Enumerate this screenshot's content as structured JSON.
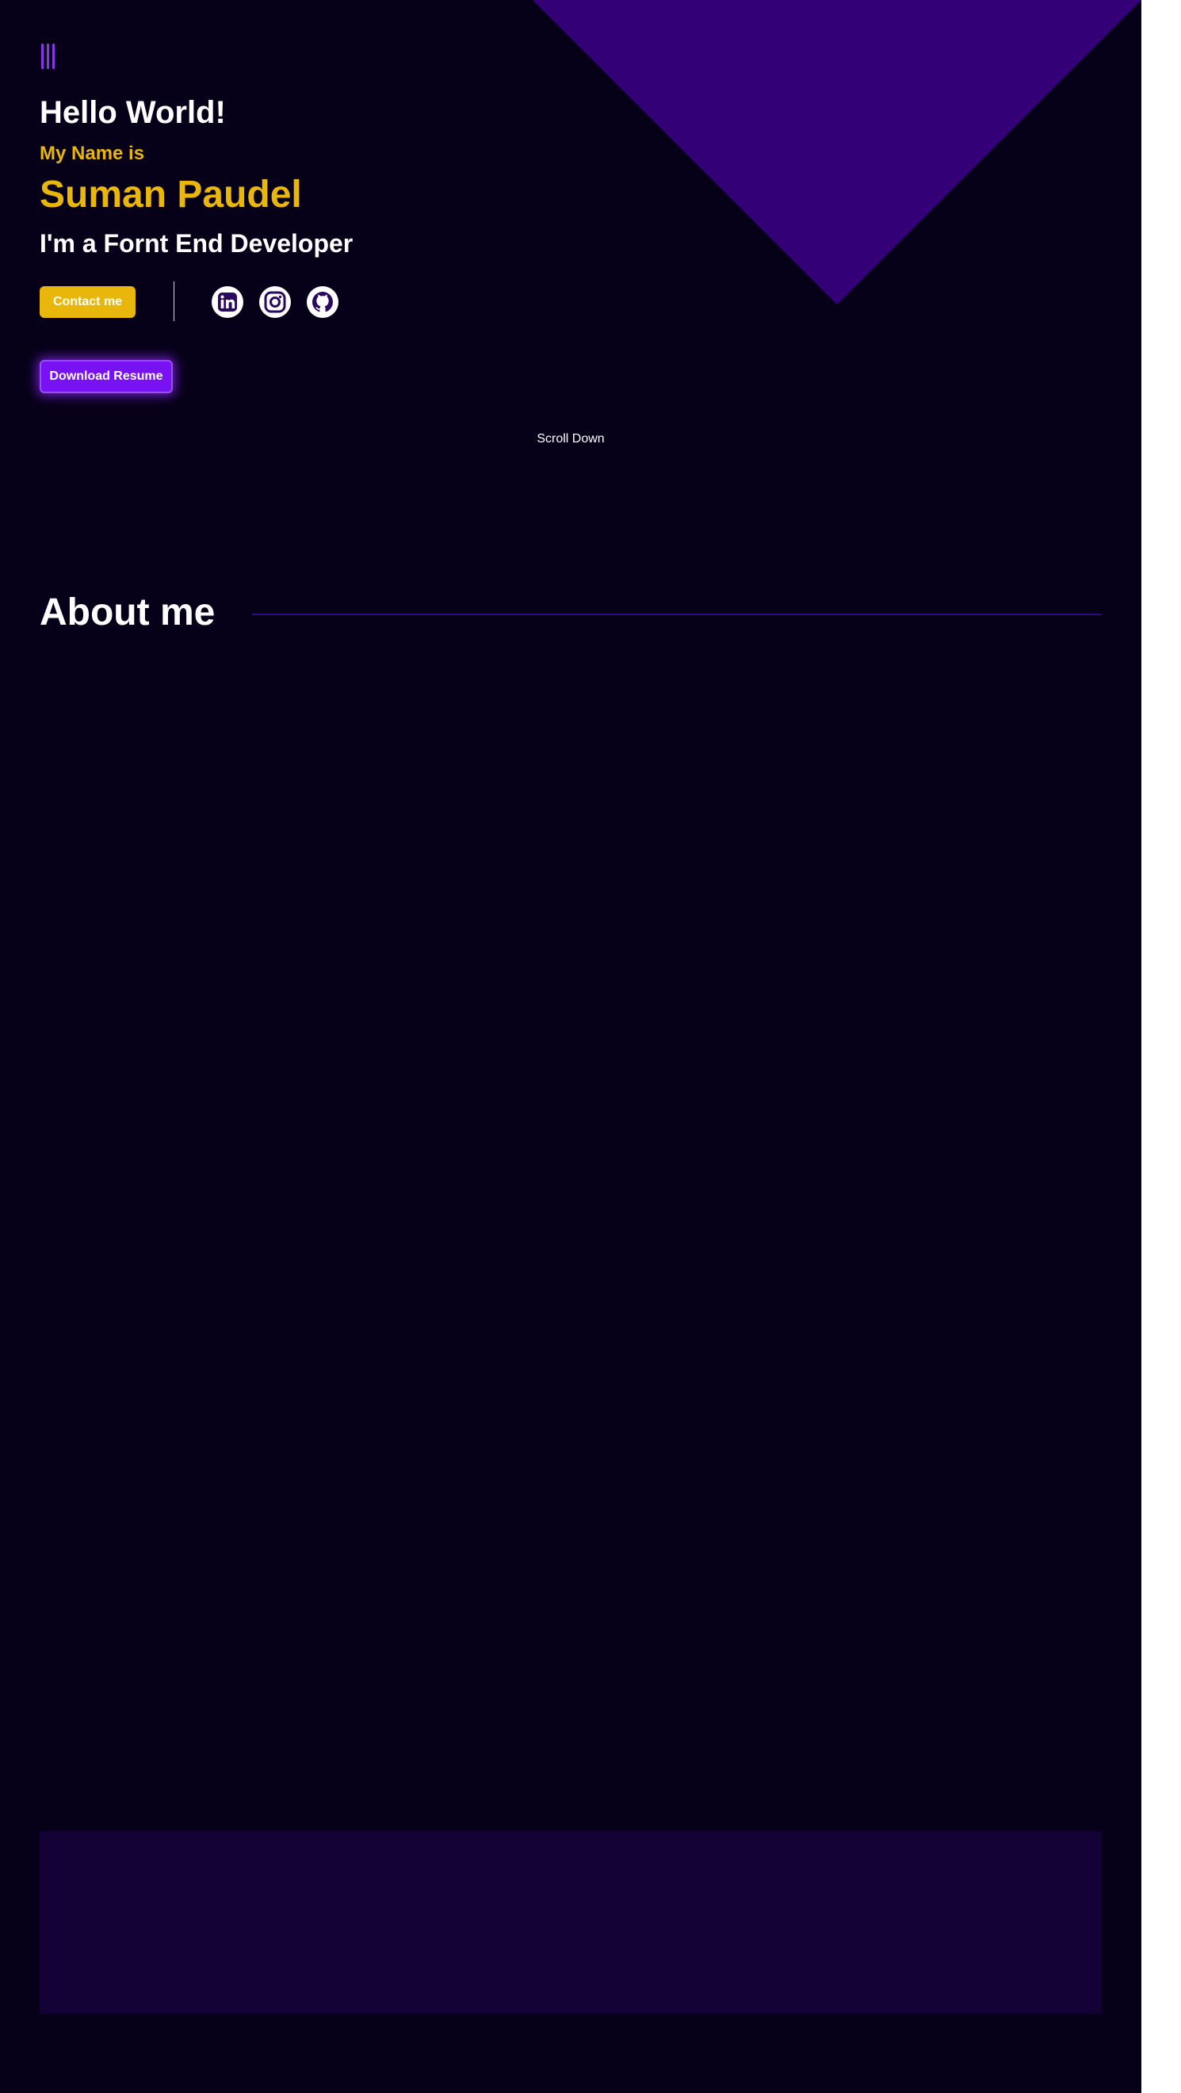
{
  "colors": {
    "background": "#070019",
    "triangle": "#330077",
    "accent_yellow": "#e9b60c",
    "accent_purple": "#7912f2",
    "menu_purple": "#8a35e8",
    "icon_dark": "#2a0a5e",
    "footer_box": "#140136"
  },
  "nav": {
    "menu_icon": "hamburger-menu-icon"
  },
  "hero": {
    "greeting": "Hello World!",
    "intro": "My Name is",
    "name": "Suman Paudel",
    "role": "I'm a Fornt End Developer",
    "contact_label": "Contact me",
    "resume_label": "Download Resume",
    "social": [
      {
        "icon": "linkedin-icon"
      },
      {
        "icon": "instagram-icon"
      },
      {
        "icon": "github-icon"
      }
    ]
  },
  "scroll": {
    "label": "Scroll Down"
  },
  "about": {
    "title": "About me"
  }
}
